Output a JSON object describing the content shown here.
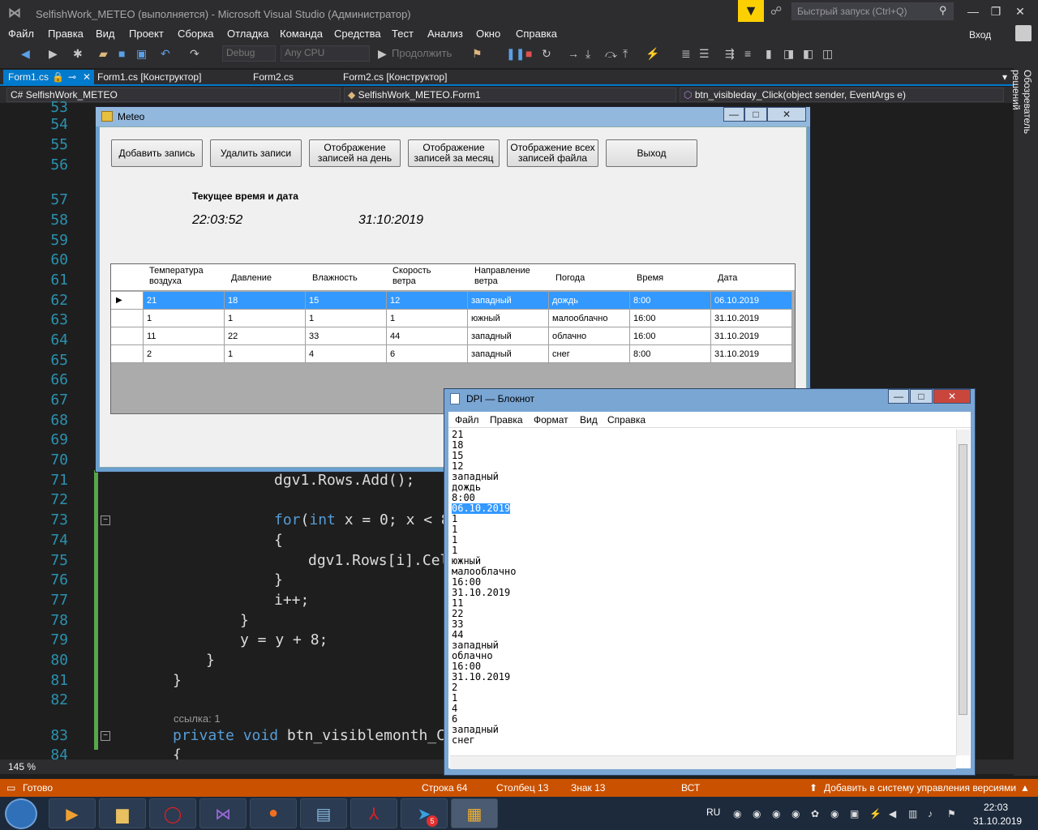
{
  "vs": {
    "title": "SelfishWork_METEO (выполняется) - Microsoft Visual Studio  (Администратор)",
    "quick_launch": "Быстрый запуск (Ctrl+Q)",
    "menu": [
      "Файл",
      "Правка",
      "Вид",
      "Проект",
      "Сборка",
      "Отладка",
      "Команда",
      "Средства",
      "Тест",
      "Анализ",
      "Окно",
      "Справка"
    ],
    "login": "Вход",
    "toolbar": {
      "config": "Debug",
      "platform": "Any CPU",
      "continue": "Продолжить"
    },
    "tabs": [
      "Form1.cs",
      "Form1.cs [Конструктор]",
      "Form2.cs",
      "Form2.cs [Конструктор]"
    ],
    "nav": {
      "project": "SelfishWork_METEO",
      "class": "SelfishWork_METEO.Form1",
      "member": "btn_visibleday_Click(object sender, EventArgs e)"
    },
    "solution_explorer": "Обозреватель решений",
    "zoom": "145 %",
    "codelens": "ссылка: 1",
    "line_numbers": [
      "53",
      "54",
      "55",
      "56",
      "57",
      "58",
      "59",
      "60",
      "61",
      "62",
      "63",
      "64",
      "65",
      "66",
      "67",
      "68",
      "69",
      "70",
      "71",
      "72",
      "73",
      "74",
      "75",
      "76",
      "77",
      "78",
      "79",
      "80",
      "81",
      "82",
      "83",
      "84"
    ],
    "code": {
      "l71": "dgv1.Rows.Add();",
      "l73_kw1": "for",
      "l73_kw2": "int",
      "l73_rest": " x = 0; x < 8",
      "l74": "{",
      "l75": "dgv1.Rows[i].Cel",
      "l76": "}",
      "l77": "i++;",
      "l78": "}",
      "l79": "y = y + 8;",
      "l80": "}",
      "l81": "}",
      "l83_kw1": "private",
      "l83_kw2": "void",
      "l83_rest": " btn_visiblemonth_Cl",
      "l84": "{"
    }
  },
  "status": {
    "ready": "Готово",
    "row": "Строка 64",
    "col": "Столбец 13",
    "char": "Знак 13",
    "ins": "ВСТ",
    "vcs": "Добавить в систему управления версиями"
  },
  "taskbar": {
    "lang": "RU",
    "time": "22:03",
    "date": "31.10.2019",
    "telegram_badge": "5"
  },
  "meteo": {
    "title": "Meteo",
    "buttons": [
      "Добавить запись",
      "Удалить записи",
      "Отображение записей на день",
      "Отображение записей за месяц",
      "Отображение всех записей файла",
      "Выход"
    ],
    "now_label": "Текущее время и дата",
    "time": "22:03:52",
    "date": "31:10:2019",
    "columns": [
      "Температура воздуха",
      "Давление",
      "Влажность",
      "Скорость ветра",
      "Направление ветра",
      "Погода",
      "Время",
      "Дата"
    ],
    "rows": [
      [
        "21",
        "18",
        "15",
        "12",
        "западный",
        "дождь",
        "8:00",
        "06.10.2019"
      ],
      [
        "1",
        "1",
        "1",
        "1",
        "южный",
        "малооблачно",
        "16:00",
        "31.10.2019"
      ],
      [
        "11",
        "22",
        "33",
        "44",
        "западный",
        "облачно",
        "16:00",
        "31.10.2019"
      ],
      [
        "2",
        "1",
        "4",
        "6",
        "западный",
        "снег",
        "8:00",
        "31.10.2019"
      ]
    ]
  },
  "notepad": {
    "title": "DPI — Блокнот",
    "menu": [
      "Файл",
      "Правка",
      "Формат",
      "Вид",
      "Справка"
    ],
    "lines": [
      "21",
      "18",
      "15",
      "12",
      "западный",
      "дождь",
      "8:00",
      "06.10.2019",
      "1",
      "1",
      "1",
      "1",
      "южный",
      "малооблачно",
      "16:00",
      "31.10.2019",
      "11",
      "22",
      "33",
      "44",
      "западный",
      "облачно",
      "16:00",
      "31.10.2019",
      "2",
      "1",
      "4",
      "6",
      "западный",
      "снег"
    ]
  },
  "colors": {
    "accent": "#007acc",
    "status": "#ca5100",
    "selection": "#3399ff"
  }
}
